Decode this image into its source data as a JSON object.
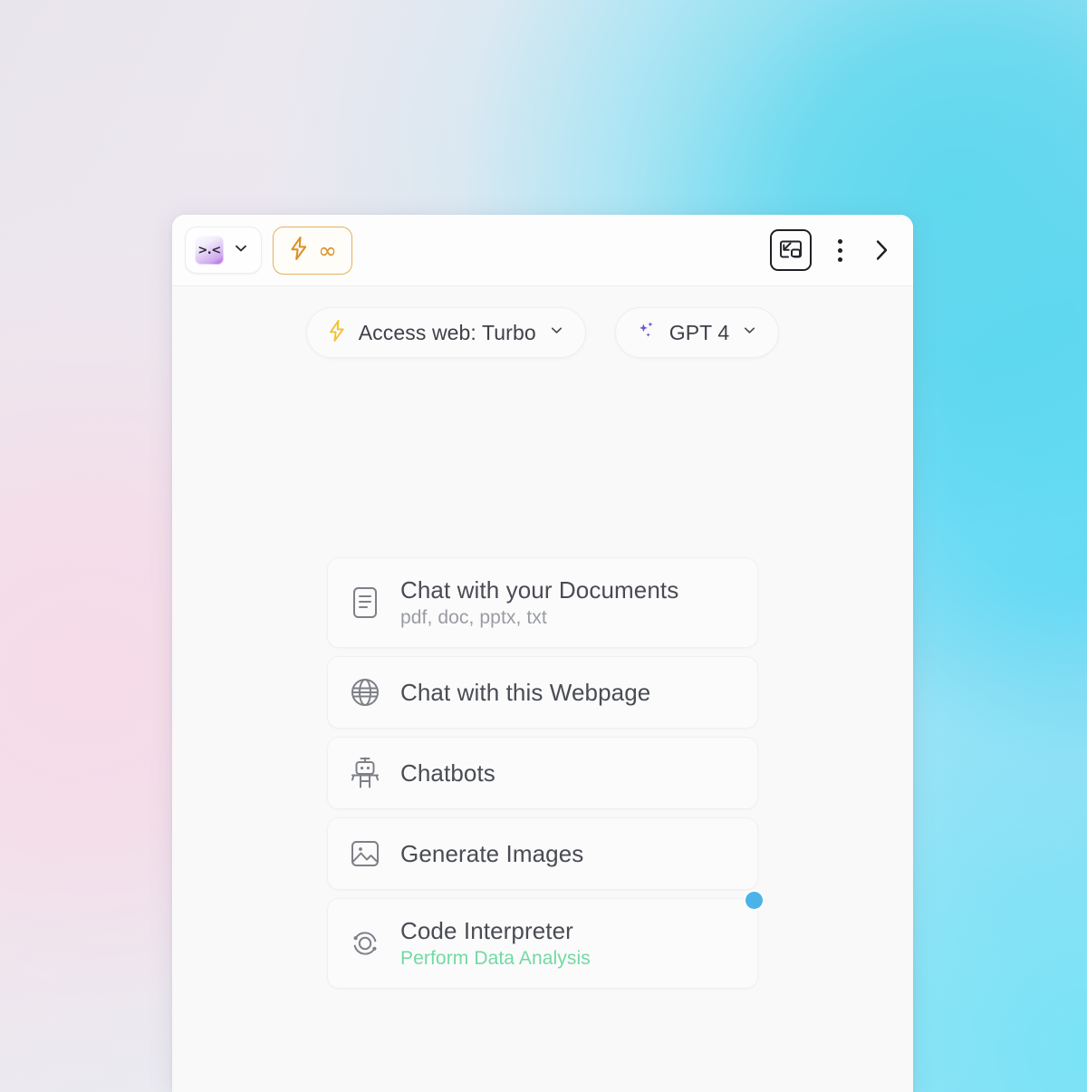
{
  "header": {
    "avatar_button": {
      "name": "avatar-selector",
      "face_glyph": ">.<",
      "chevron": "chevron-down-icon"
    },
    "turbo_button": {
      "name": "turbo-unlimited-toggle",
      "bolt_icon": "lightning-bolt-icon",
      "infinity_glyph": "∞"
    },
    "pip_button_label": "picture-in-picture-icon",
    "kebab_button_label": "more-options-icon",
    "collapse_button_label": "chevron-right-icon"
  },
  "chips": [
    {
      "icon": "lightning-bolt-icon",
      "label": "Access web: Turbo",
      "chevron": "chevron-down-icon"
    },
    {
      "icon": "sparkles-icon",
      "label": "GPT 4",
      "chevron": "chevron-down-icon"
    }
  ],
  "cards": [
    {
      "icon": "document-icon",
      "title": "Chat with your Documents",
      "subtitle": "pdf, doc, pptx, txt",
      "subtitle_style": "muted",
      "badge": false
    },
    {
      "icon": "globe-icon",
      "title": "Chat with this Webpage",
      "subtitle": "",
      "subtitle_style": "muted",
      "badge": false
    },
    {
      "icon": "robot-icon",
      "title": "Chatbots",
      "subtitle": "",
      "subtitle_style": "muted",
      "badge": false
    },
    {
      "icon": "image-icon",
      "title": "Generate Images",
      "subtitle": "",
      "subtitle_style": "muted",
      "badge": false
    },
    {
      "icon": "orbit-icon",
      "title": "Code Interpreter",
      "subtitle": "Perform Data Analysis",
      "subtitle_style": "green",
      "badge": true
    }
  ],
  "colors": {
    "accent_orange": "#d98f28",
    "accent_yellow": "#f2c230",
    "accent_purple": "#6d5bd0",
    "badge_blue": "#4cb3e8",
    "subtitle_green": "#73d9a2",
    "panel_bg": "#f9f9fa"
  }
}
